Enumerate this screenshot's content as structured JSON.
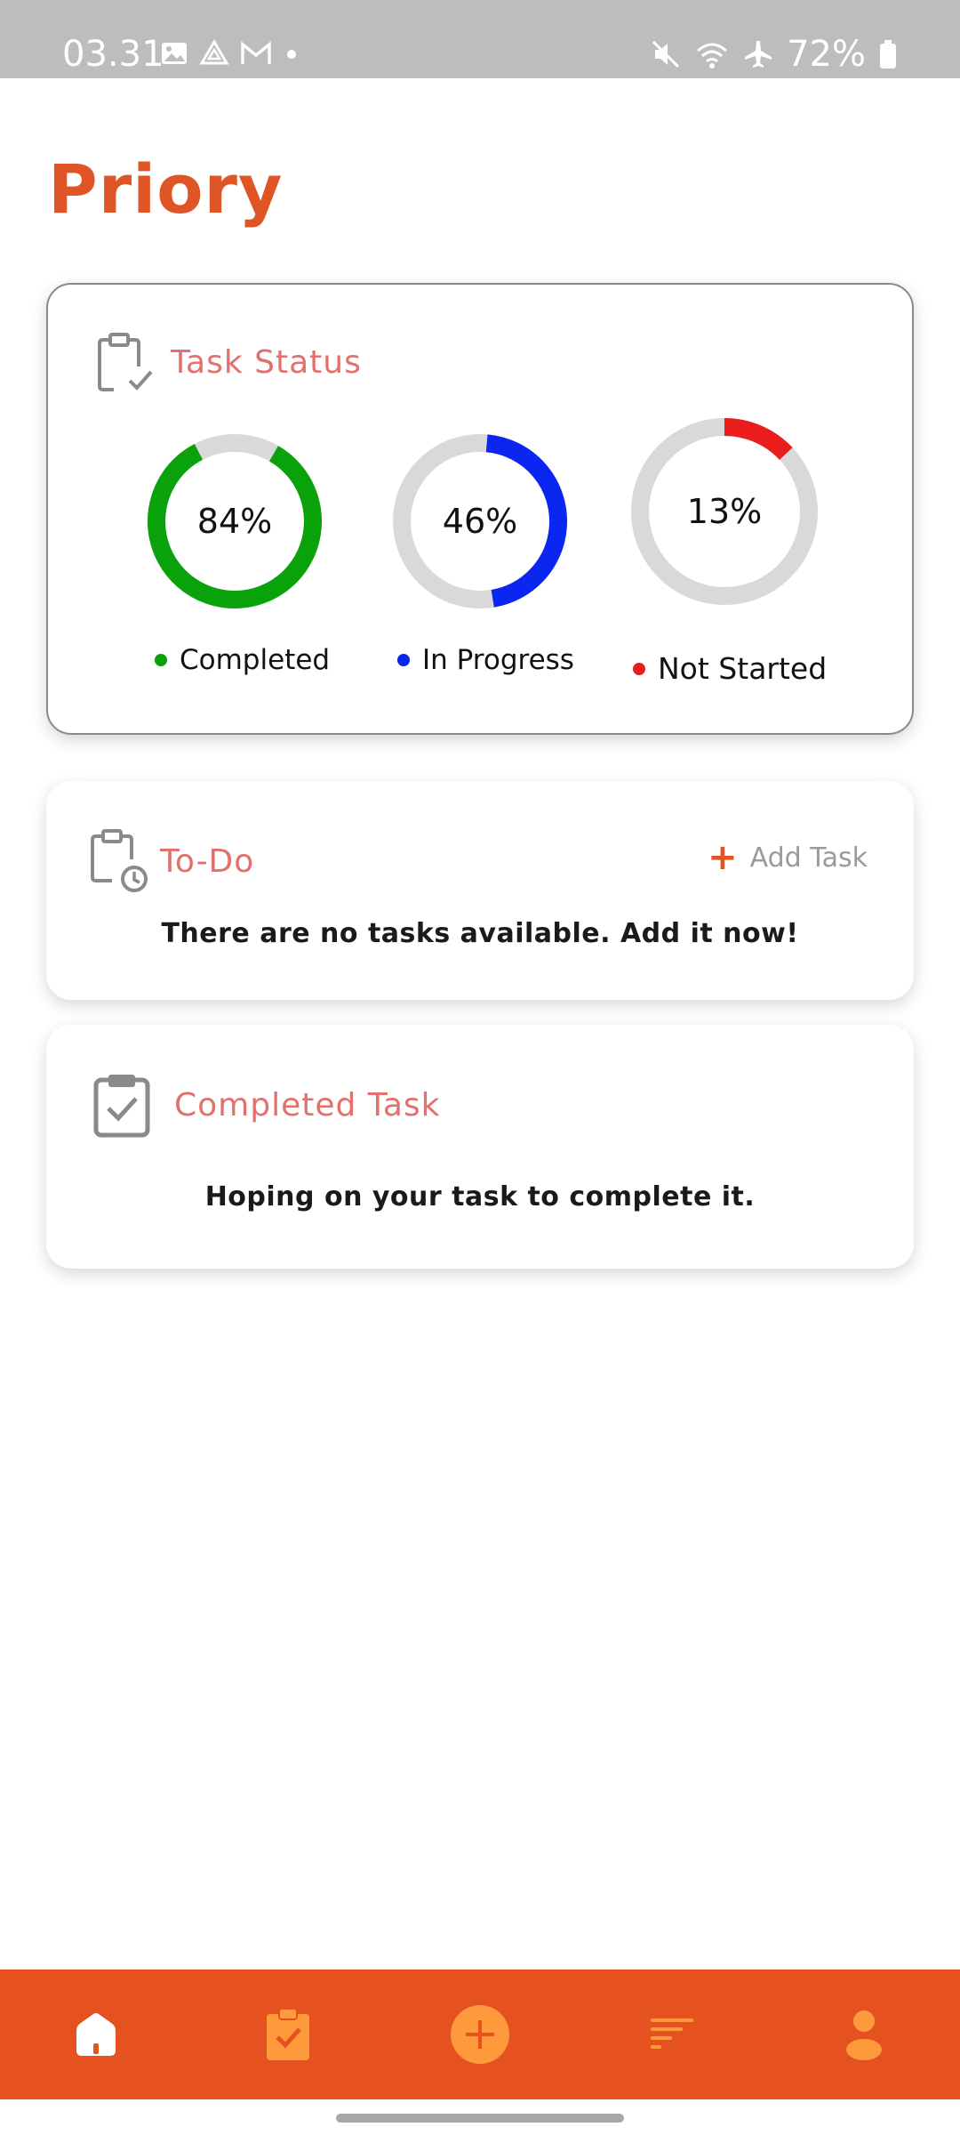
{
  "status_bar": {
    "time": "03.31",
    "battery": "72%",
    "icons_left": [
      "image-icon",
      "drive-icon",
      "gmail-icon",
      "dot-icon"
    ],
    "icons_right": [
      "mute-icon",
      "wifi-icon",
      "airplane-icon",
      "battery-icon"
    ]
  },
  "app": {
    "title": "Priory"
  },
  "task_status": {
    "title": "Task Status",
    "rings": [
      {
        "label": "84%",
        "value": 0.84,
        "color": "#0aa20a",
        "legend": "Completed"
      },
      {
        "label": "46%",
        "value": 0.46,
        "color": "#0a26f0",
        "legend": "In Progress"
      },
      {
        "label": "13%",
        "value": 0.13,
        "color": "#ea1c1c",
        "legend": "Not Started"
      }
    ],
    "track_color": "#d9d9d9"
  },
  "todo": {
    "title": "To-Do",
    "add_label": "Add Task",
    "empty_message": "There are no tasks available. Add it now!"
  },
  "completed": {
    "title": "Completed Task",
    "empty_message": "Hoping on your task to complete it."
  },
  "bottom_nav": {
    "items": [
      "home-icon",
      "tasks-icon",
      "add-icon",
      "sort-icon",
      "profile-icon"
    ]
  },
  "colors": {
    "accent": "#e5521f",
    "title_red": "#e3706c",
    "nav_icon": "#ff9a3c"
  }
}
